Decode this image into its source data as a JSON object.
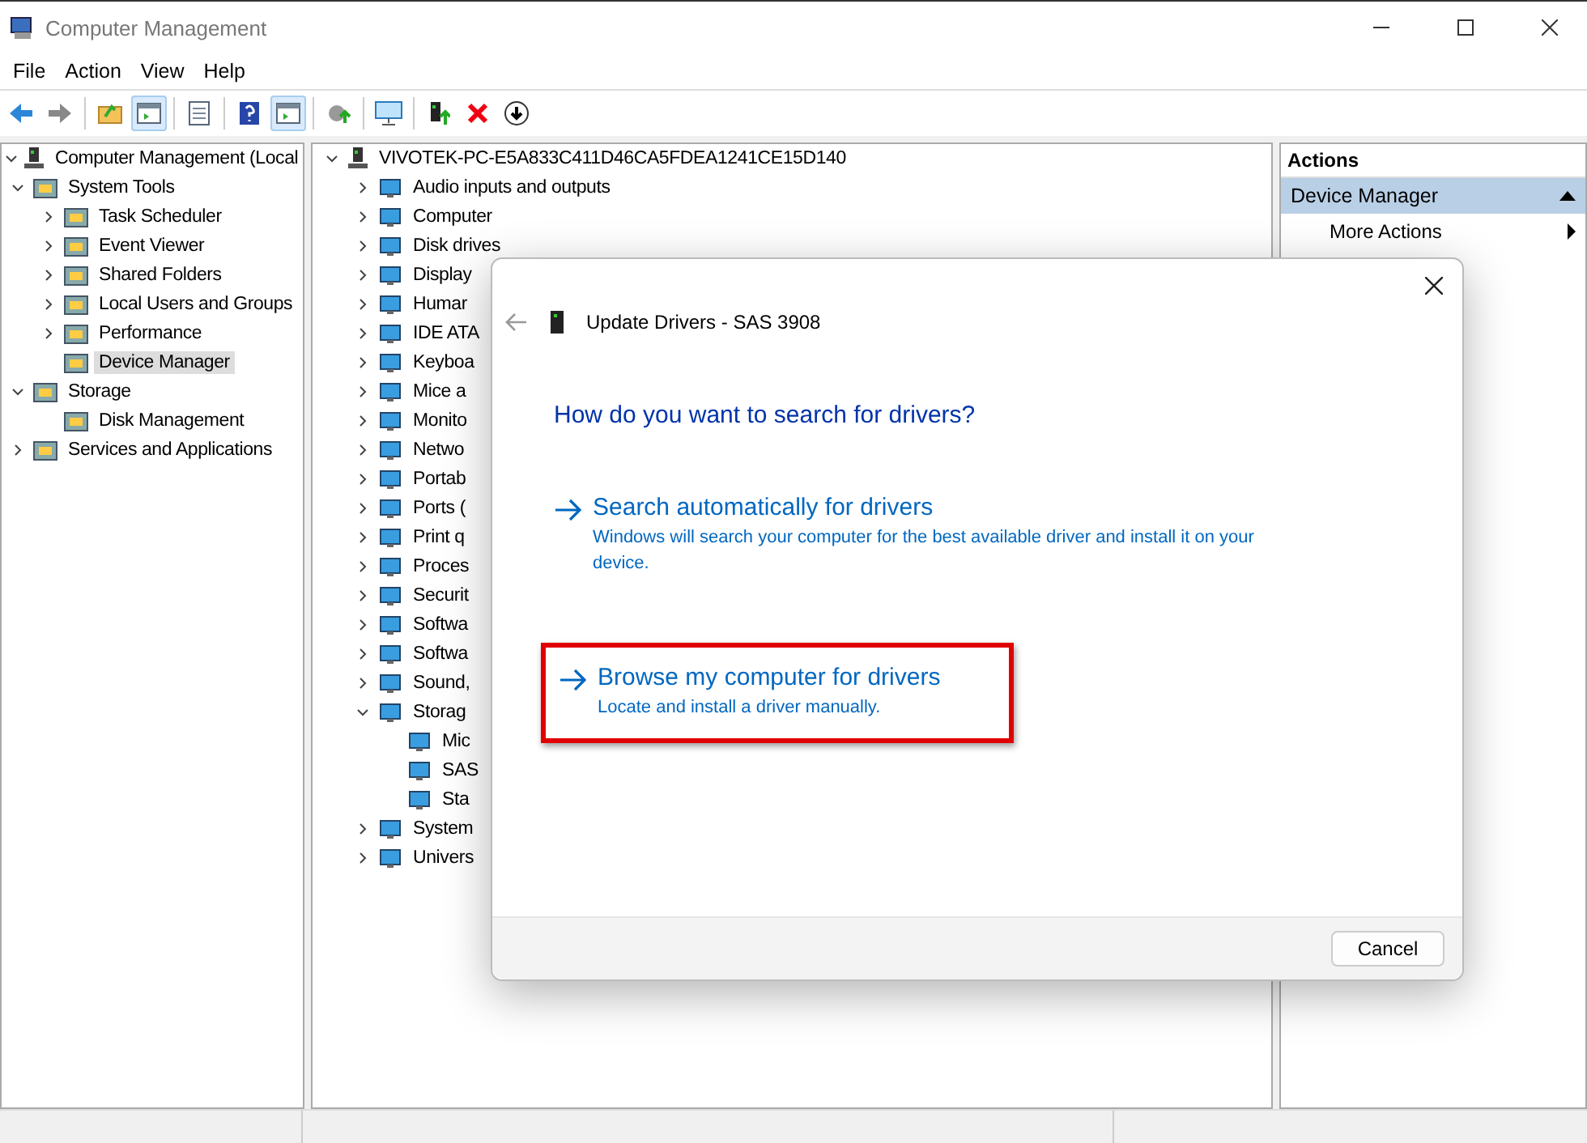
{
  "window": {
    "title": "Computer Management"
  },
  "menu": [
    {
      "label": "File"
    },
    {
      "label": "Action"
    },
    {
      "label": "View"
    },
    {
      "label": "Help"
    }
  ],
  "toolbar": [
    {
      "kind": "back",
      "selected": false
    },
    {
      "kind": "forward",
      "selected": false
    },
    {
      "kind": "sep"
    },
    {
      "kind": "up",
      "selected": false
    },
    {
      "kind": "pane",
      "selected": true
    },
    {
      "kind": "sep"
    },
    {
      "kind": "props",
      "selected": false
    },
    {
      "kind": "sep"
    },
    {
      "kind": "help",
      "selected": false
    },
    {
      "kind": "pane",
      "selected": true
    },
    {
      "kind": "sep"
    },
    {
      "kind": "export",
      "selected": false
    },
    {
      "kind": "sep"
    },
    {
      "kind": "monitor",
      "selected": false
    },
    {
      "kind": "sep"
    },
    {
      "kind": "update",
      "selected": false
    },
    {
      "kind": "delete",
      "selected": false
    },
    {
      "kind": "down",
      "selected": false
    }
  ],
  "console_tree": [
    {
      "label": "Computer Management (Local",
      "expanded": true,
      "selected": false,
      "children": [
        {
          "label": "System Tools",
          "expanded": true,
          "selected": false,
          "children": [
            {
              "label": "Task Scheduler",
              "expanded": false,
              "selected": false
            },
            {
              "label": "Event Viewer",
              "expanded": false,
              "selected": false
            },
            {
              "label": "Shared Folders",
              "expanded": false,
              "selected": false
            },
            {
              "label": "Local Users and Groups",
              "expanded": false,
              "selected": false
            },
            {
              "label": "Performance",
              "expanded": false,
              "selected": false
            },
            {
              "label": "Device Manager",
              "selected": true
            }
          ]
        },
        {
          "label": "Storage",
          "expanded": true,
          "selected": false,
          "children": [
            {
              "label": "Disk Management",
              "selected": false
            }
          ]
        },
        {
          "label": "Services and Applications",
          "expanded": false,
          "selected": false
        }
      ]
    }
  ],
  "device_tree": {
    "label": "VIVOTEK-PC-E5A833C411D46CA5FDEA1241CE15D140",
    "expanded": true,
    "children": [
      {
        "label": "Audio inputs and outputs",
        "expanded": false
      },
      {
        "label": "Computer",
        "expanded": false
      },
      {
        "label": "Disk drives",
        "expanded": false
      },
      {
        "label": "Display",
        "expanded": false
      },
      {
        "label": "Humar",
        "expanded": false
      },
      {
        "label": "IDE ATA",
        "expanded": false
      },
      {
        "label": "Keyboa",
        "expanded": false
      },
      {
        "label": "Mice a",
        "expanded": false
      },
      {
        "label": "Monito",
        "expanded": false
      },
      {
        "label": "Netwo",
        "expanded": false
      },
      {
        "label": "Portab",
        "expanded": false
      },
      {
        "label": "Ports (",
        "expanded": false
      },
      {
        "label": "Print q",
        "expanded": false
      },
      {
        "label": "Proces",
        "expanded": false
      },
      {
        "label": "Securit",
        "expanded": false
      },
      {
        "label": "Softwa",
        "expanded": false
      },
      {
        "label": "Softwa",
        "expanded": false
      },
      {
        "label": "Sound,",
        "expanded": false
      },
      {
        "label": "Storag",
        "expanded": true,
        "children": [
          {
            "label": "Mic"
          },
          {
            "label": "SAS"
          },
          {
            "label": "Sta"
          }
        ]
      },
      {
        "label": "System",
        "expanded": false
      },
      {
        "label": "Univers",
        "expanded": false
      }
    ]
  },
  "actions": {
    "title": "Actions",
    "section": {
      "label": "Device Manager",
      "expanded": true
    },
    "items": [
      {
        "label": "More Actions"
      }
    ]
  },
  "dialog": {
    "title": "Update Drivers - SAS 3908",
    "heading": "How do you want to search for drivers?",
    "options": [
      {
        "title": "Search automatically for drivers",
        "description": "Windows will search your computer for the best available driver and install it on your device.",
        "highlighted": false
      },
      {
        "title": "Browse my computer for drivers",
        "description": "Locate and install a driver manually.",
        "highlighted": true
      }
    ],
    "buttons": [
      "Cancel"
    ]
  }
}
